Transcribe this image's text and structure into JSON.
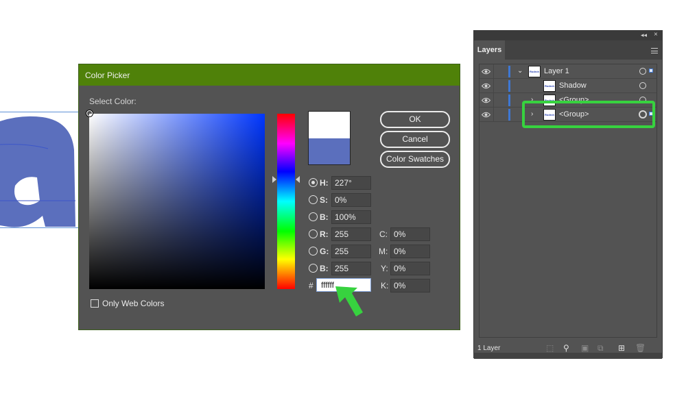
{
  "color_picker": {
    "title": "Color Picker",
    "select_color_label": "Select Color:",
    "new_color": "#ffffff",
    "current_color": "#5b6fbd",
    "buttons": {
      "ok": "OK",
      "cancel": "Cancel",
      "swatches": "Color Swatches"
    },
    "hsb": [
      {
        "label": "H:",
        "value": "227°",
        "selected": true
      },
      {
        "label": "S:",
        "value": "0%",
        "selected": false
      },
      {
        "label": "B:",
        "value": "100%",
        "selected": false
      }
    ],
    "rgb": [
      {
        "label": "R:",
        "value": "255"
      },
      {
        "label": "G:",
        "value": "255"
      },
      {
        "label": "B:",
        "value": "255"
      }
    ],
    "cmyk": [
      {
        "label": "C:",
        "value": "0%"
      },
      {
        "label": "M:",
        "value": "0%"
      },
      {
        "label": "Y:",
        "value": "0%"
      },
      {
        "label": "K:",
        "value": "0%"
      }
    ],
    "hex_label": "#",
    "hex_value": "ffffff",
    "only_web_colors": "Only Web Colors",
    "only_web_colors_checked": false
  },
  "layers_panel": {
    "tab": "Layers",
    "rows": [
      {
        "name": "Layer 1",
        "thumb": "Rodrch"
      },
      {
        "name": "Shadow",
        "thumb": "Rodrch"
      },
      {
        "name": "<Group>",
        "thumb": "Rodrch"
      },
      {
        "name": "<Group>",
        "thumb": "Rodrch"
      }
    ],
    "footer_count": "1 Layer"
  },
  "colors": {
    "title_bar": "#4f8109",
    "highlight": "#37d23f",
    "accent_blue": "#3e78d4",
    "letter_fill": "#5b6fbd"
  }
}
